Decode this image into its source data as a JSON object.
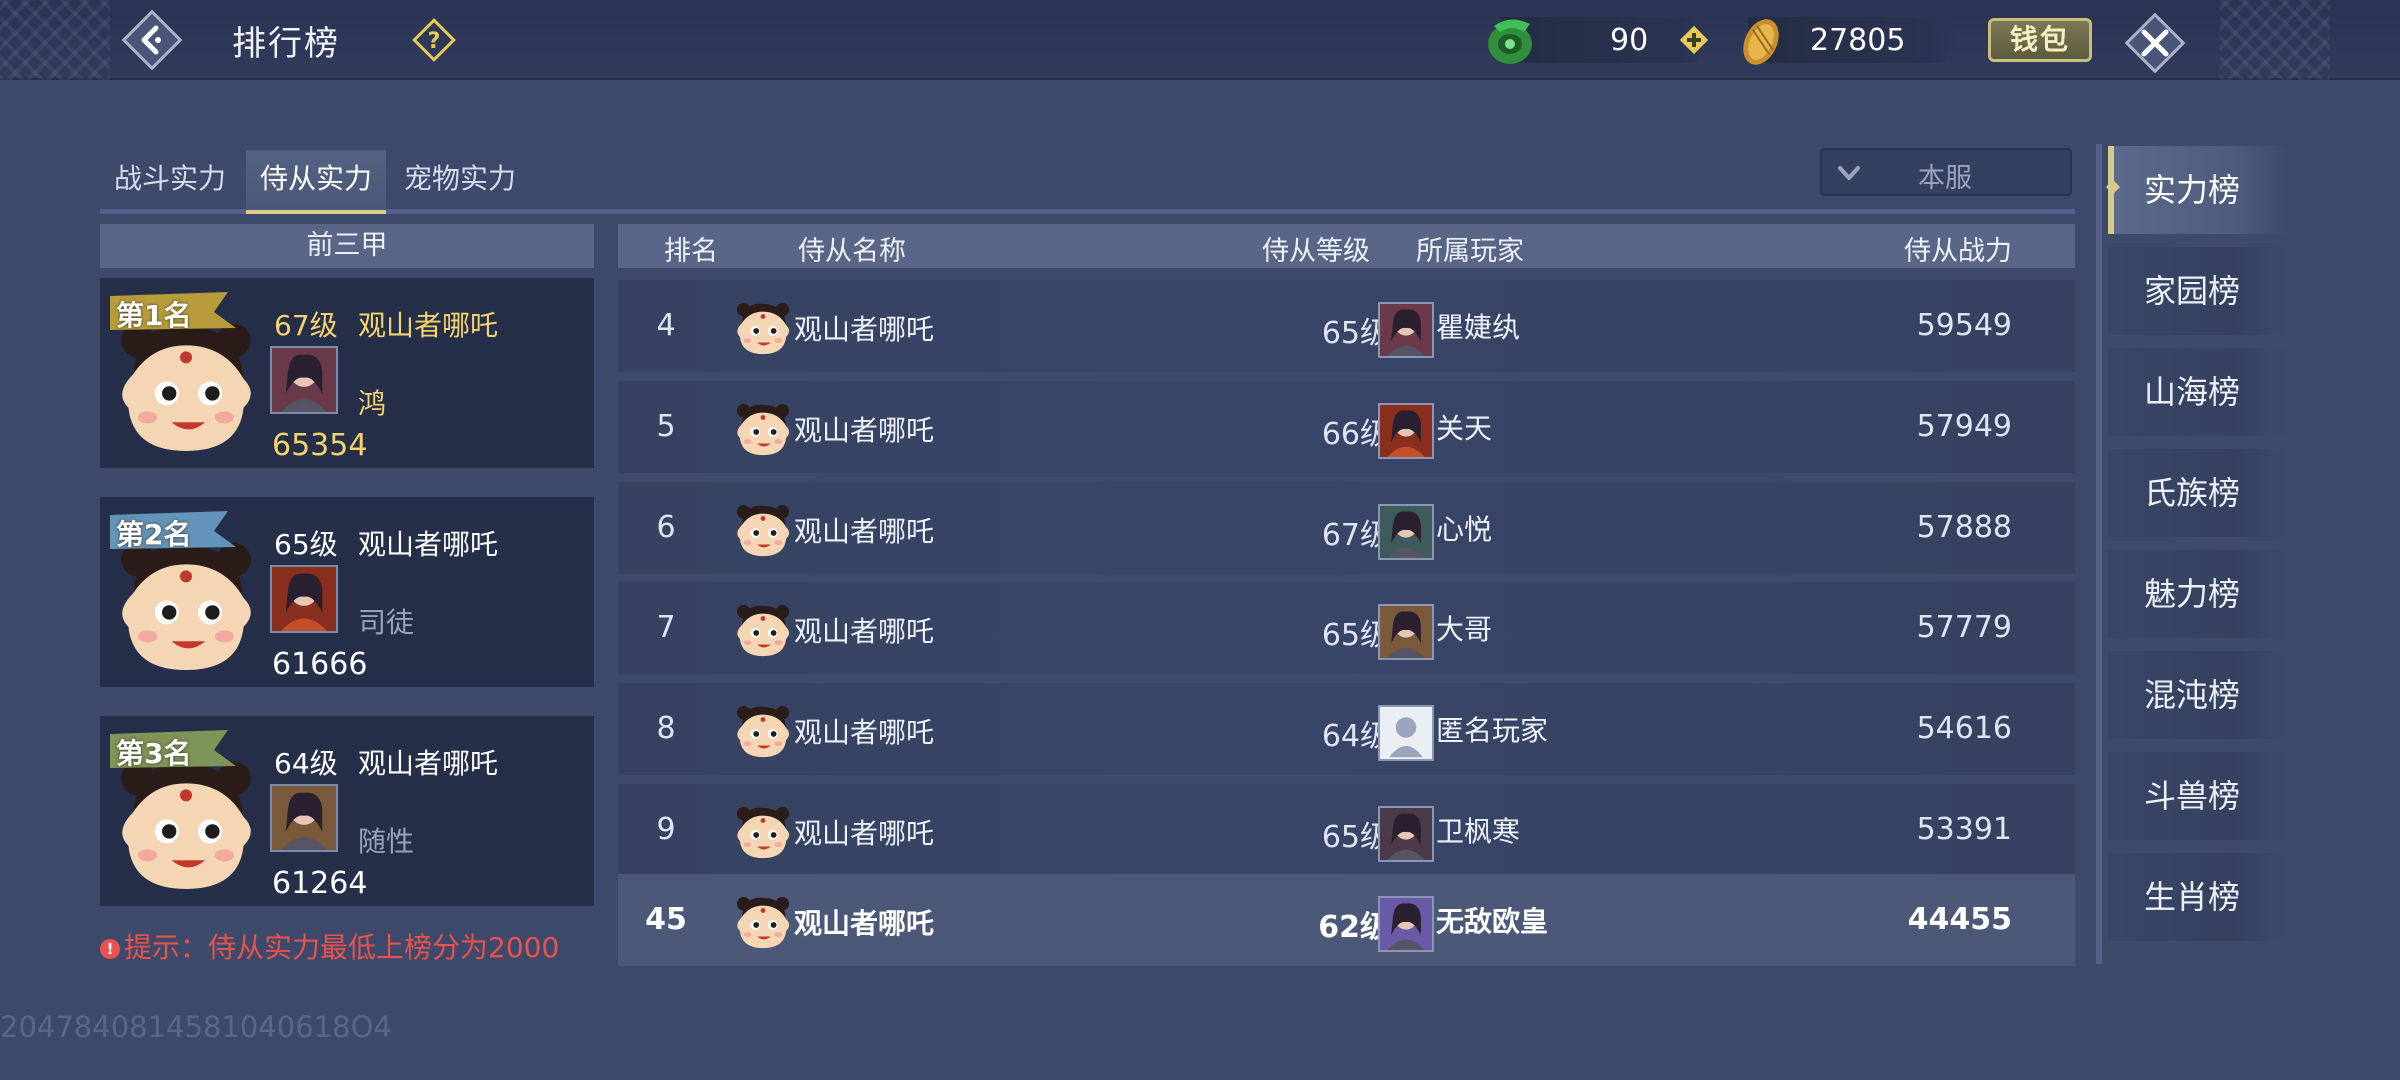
{
  "header": {
    "title": "排行榜",
    "jade_amount": "90",
    "coin_amount": "27805",
    "wallet_label": "钱包"
  },
  "tabs": [
    {
      "label": "战斗实力",
      "active": false
    },
    {
      "label": "侍从实力",
      "active": true
    },
    {
      "label": "宠物实力",
      "active": false
    }
  ],
  "server_select": {
    "label": "本服"
  },
  "top3": {
    "header": "前三甲",
    "cards": [
      {
        "rank_label": "第1名",
        "level": "67级",
        "pet_name": "观山者哪吒",
        "owner": "鸿",
        "power": "65354",
        "ribbon": "#c9a93a"
      },
      {
        "rank_label": "第2名",
        "level": "65级",
        "pet_name": "观山者哪吒",
        "owner": "司徒",
        "power": "61666",
        "ribbon": "#6aa0c6"
      },
      {
        "rank_label": "第3名",
        "level": "64级",
        "pet_name": "观山者哪吒",
        "owner": "随性",
        "power": "61264",
        "ribbon": "#8aa05a"
      }
    ]
  },
  "tip": "提示：侍从实力最低上榜分为2000",
  "table": {
    "columns": {
      "rank": "排名",
      "pet_name": "侍从名称",
      "pet_level": "侍从等级",
      "owner": "所属玩家",
      "power": "侍从战力"
    },
    "rows": [
      {
        "rank": "4",
        "pet_name": "观山者哪吒",
        "pet_level": "65级",
        "owner": "瞿婕纨",
        "power": "59549"
      },
      {
        "rank": "5",
        "pet_name": "观山者哪吒",
        "pet_level": "66级",
        "owner": "关天",
        "power": "57949"
      },
      {
        "rank": "6",
        "pet_name": "观山者哪吒",
        "pet_level": "67级",
        "owner": "心悦",
        "power": "57888"
      },
      {
        "rank": "7",
        "pet_name": "观山者哪吒",
        "pet_level": "65级",
        "owner": "大哥",
        "power": "57779"
      },
      {
        "rank": "8",
        "pet_name": "观山者哪吒",
        "pet_level": "64级",
        "owner": "匿名玩家",
        "power": "54616"
      },
      {
        "rank": "9",
        "pet_name": "观山者哪吒",
        "pet_level": "65级",
        "owner": "卫枫寒",
        "power": "53391"
      }
    ],
    "my_row": {
      "rank": "45",
      "pet_name": "观山者哪吒",
      "pet_level": "62级",
      "owner": "无敌欧皇",
      "power": "44455"
    }
  },
  "side_nav": [
    {
      "label": "实力榜",
      "active": true
    },
    {
      "label": "家园榜",
      "active": false
    },
    {
      "label": "山海榜",
      "active": false
    },
    {
      "label": "氏族榜",
      "active": false
    },
    {
      "label": "魅力榜",
      "active": false
    },
    {
      "label": "混沌榜",
      "active": false
    },
    {
      "label": "斗兽榜",
      "active": false
    },
    {
      "label": "生肖榜",
      "active": false
    }
  ],
  "uid": "2047840814581040618O4"
}
